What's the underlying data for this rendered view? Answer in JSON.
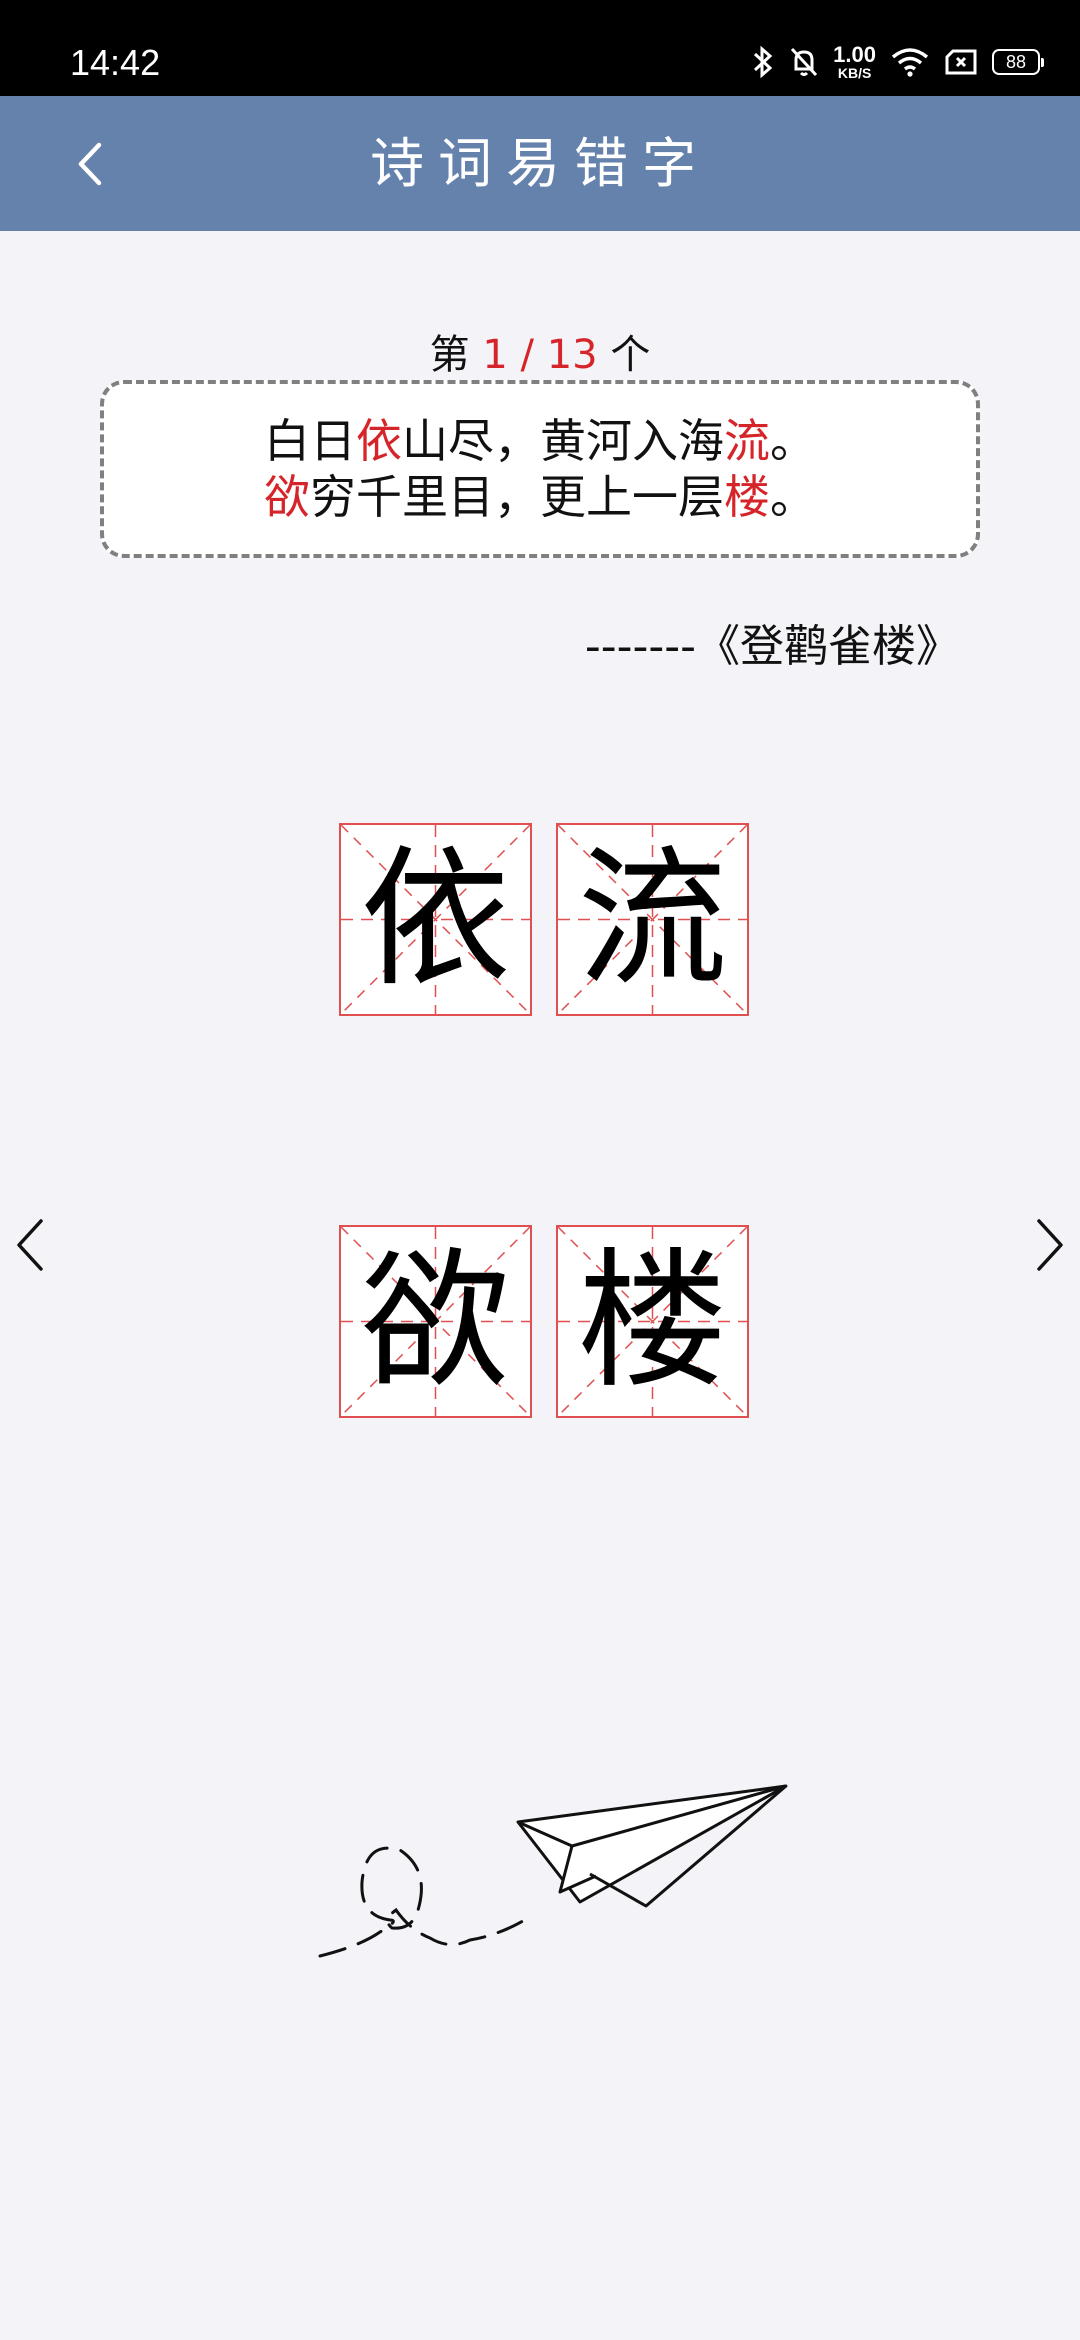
{
  "status_bar": {
    "time": "14:42",
    "net_speed_value": "1.00",
    "net_speed_unit": "KB/S",
    "battery": "88",
    "icons": [
      "bluetooth-icon",
      "mute-bell-icon",
      "wifi-icon",
      "sim-x-icon",
      "battery-icon"
    ]
  },
  "header": {
    "title": "诗词易错字",
    "background": "#6582ac"
  },
  "counter": {
    "prefix": "第",
    "current": "1",
    "separator": " / ",
    "total": "13",
    "suffix": "个"
  },
  "poem": {
    "line1": [
      {
        "text": "白日",
        "hl": false
      },
      {
        "text": "依",
        "hl": true
      },
      {
        "text": "山尽，黄河入海",
        "hl": false
      },
      {
        "text": "流",
        "hl": true
      },
      {
        "text": "。",
        "hl": false
      }
    ],
    "line2": [
      {
        "text": "欲",
        "hl": true
      },
      {
        "text": "穷千里目，更上一层",
        "hl": false
      },
      {
        "text": "楼",
        "hl": true
      },
      {
        "text": "。",
        "hl": false
      }
    ],
    "highlight_color": "#d6252a"
  },
  "source": "-------《登鹳雀楼》",
  "characters": {
    "row1": [
      "依",
      "流"
    ],
    "row2": [
      "欲",
      "楼"
    ]
  },
  "nav": {
    "prev_icon": "chevron-left-icon",
    "next_icon": "chevron-right-icon"
  },
  "illustration": "paper-plane-icon"
}
